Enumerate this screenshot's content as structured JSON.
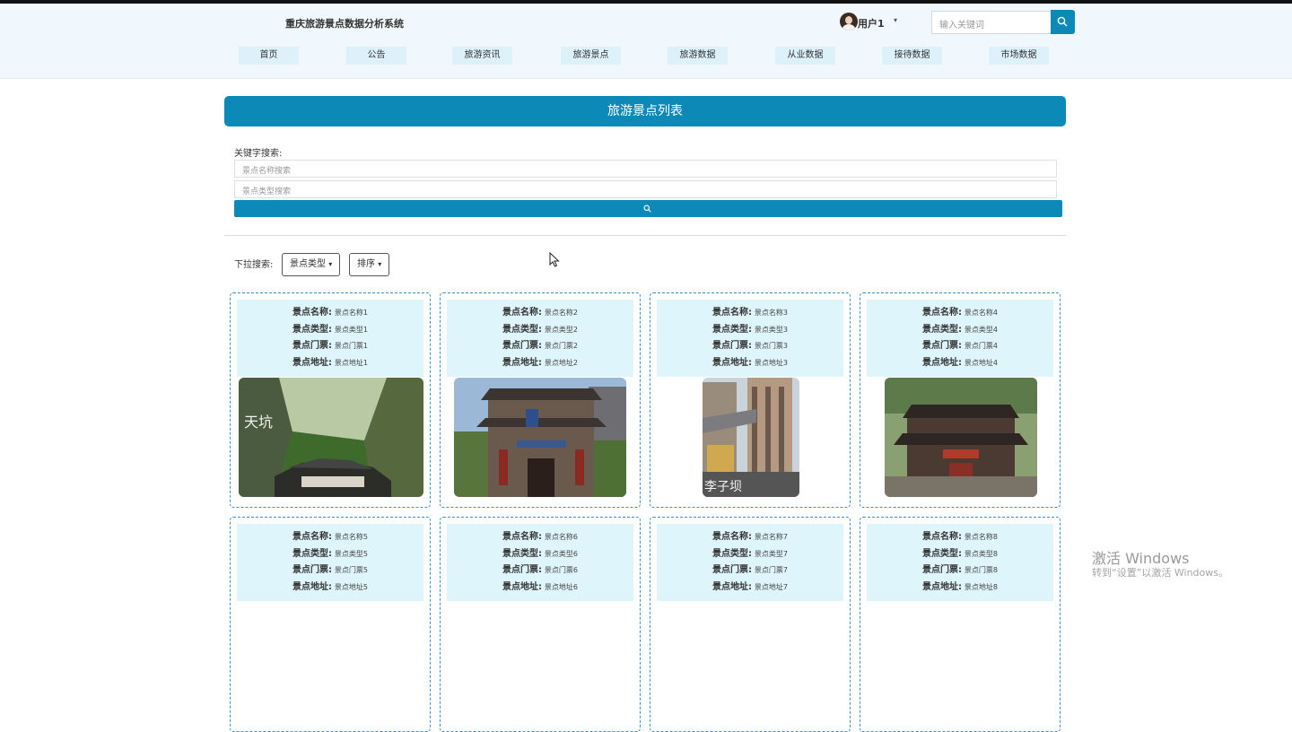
{
  "header": {
    "site_title": "重庆旅游景点数据分析系统",
    "username": "用户1",
    "user_caret": "▾",
    "search_placeholder": "输入关键词"
  },
  "nav": [
    {
      "label": "首页"
    },
    {
      "label": "公告"
    },
    {
      "label": "旅游资讯"
    },
    {
      "label": "旅游景点"
    },
    {
      "label": "旅游数据"
    },
    {
      "label": "从业数据"
    },
    {
      "label": "接待数据"
    },
    {
      "label": "市场数据"
    }
  ],
  "banner": {
    "title": "旅游景点列表"
  },
  "search": {
    "keyword_label": "关键字搜索:",
    "name_placeholder": "景点名称搜索",
    "type_placeholder": "景点类型搜索"
  },
  "dropdown": {
    "label": "下拉搜索:",
    "type_label": "景点类型",
    "sort_label": "排序",
    "caret": "▾"
  },
  "labels": {
    "name": "景点名称:",
    "type": "景点类型:",
    "ticket": "景点门票:",
    "address": "景点地址:"
  },
  "cards": [
    {
      "name": "景点名称1",
      "type": "景点类型1",
      "ticket": "景点门票1",
      "address": "景点地址1",
      "photo_text": "天坑"
    },
    {
      "name": "景点名称2",
      "type": "景点类型2",
      "ticket": "景点门票2",
      "address": "景点地址2"
    },
    {
      "name": "景点名称3",
      "type": "景点类型3",
      "ticket": "景点门票3",
      "address": "景点地址3",
      "photo_text": "李子坝"
    },
    {
      "name": "景点名称4",
      "type": "景点类型4",
      "ticket": "景点门票4",
      "address": "景点地址4"
    },
    {
      "name": "景点名称5",
      "type": "景点类型5",
      "ticket": "景点门票5",
      "address": "景点地址5"
    },
    {
      "name": "景点名称6",
      "type": "景点类型6",
      "ticket": "景点门票6",
      "address": "景点地址6"
    },
    {
      "name": "景点名称7",
      "type": "景点类型7",
      "ticket": "景点门票7",
      "address": "景点地址7"
    },
    {
      "name": "景点名称8",
      "type": "景点类型8",
      "ticket": "景点门票8",
      "address": "景点地址8"
    }
  ],
  "watermark": {
    "line1": "激活 Windows",
    "line2": "转到“设置”以激活 Windows。"
  },
  "colors": {
    "primary": "#0d89b7",
    "nav_bg": "#ddf1fb",
    "info_bg": "#dff5fc",
    "header_bg": "#f0f8fd"
  },
  "icons": {
    "search": "search-icon",
    "cursor": "mouse-pointer-icon",
    "avatar": "user-avatar"
  }
}
